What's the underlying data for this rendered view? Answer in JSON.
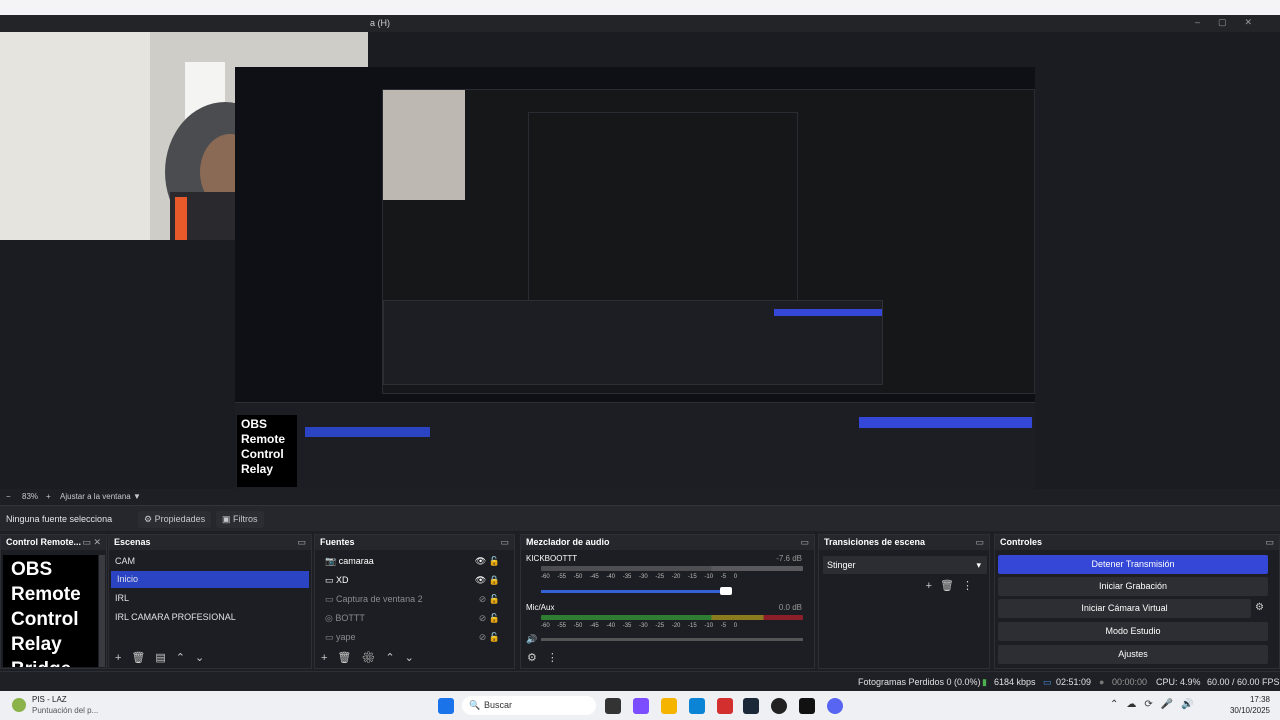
{
  "menu": {
    "label": "a (H)"
  },
  "zoom": {
    "minus": "−",
    "value": "83%",
    "plus": "+",
    "fit_label": "Ajustar a la ventana",
    "arrow": "▼"
  },
  "srcbar": {
    "no_source": "Ninguna fuente selecciona",
    "properties": "Propiedades",
    "filters": "Filtros"
  },
  "docks": {
    "remote": {
      "title": "Control Remote...",
      "logo": [
        "OBS",
        "Remote",
        "Control",
        "Relay",
        "Bridge"
      ]
    },
    "scenes": {
      "title": "Escenas",
      "items": [
        "CAM",
        "Inicio",
        "IRL",
        "IRL CAMARA PROFESIONAL"
      ],
      "selected": 1
    },
    "sources": {
      "title": "Fuentes",
      "items": [
        "camaraa",
        "XD",
        "Captura de ventana 2",
        "BOTTT",
        "yape"
      ]
    },
    "mixer": {
      "title": "Mezclador de audio",
      "tracks": [
        {
          "name": "KICKBOOTTT",
          "db": "-7.6 dB",
          "level": 0.88
        },
        {
          "name": "Mic/Aux",
          "db": "0.0 dB",
          "level": 1.0
        }
      ],
      "scale": [
        "-60",
        "-55",
        "-50",
        "-45",
        "-40",
        "-35",
        "-30",
        "-25",
        "-20",
        "-15",
        "-10",
        "-5",
        "0"
      ]
    },
    "transitions": {
      "title": "Transiciones de escena",
      "selected": "Stinger"
    },
    "controls": {
      "title": "Controles",
      "buttons": [
        "Detener Transmisión",
        "Iniciar Grabación",
        "Iniciar Cámara Virtual",
        "Modo Estudio",
        "Ajustes"
      ]
    }
  },
  "status": {
    "dropped": "Fotogramas Perdidos 0 (0.0%)",
    "bitrate": "6184 kbps",
    "stream_time": "02:51:09",
    "rec_time": "00:00:00",
    "cpu": "CPU: 4.9%",
    "fps": "60.00 / 60.00 FPS"
  },
  "taskbar": {
    "app_title": "PIS - LAZ",
    "app_sub": "Puntuación del p...",
    "search": "Buscar",
    "time": "17:38",
    "date": "30/10/2025"
  }
}
